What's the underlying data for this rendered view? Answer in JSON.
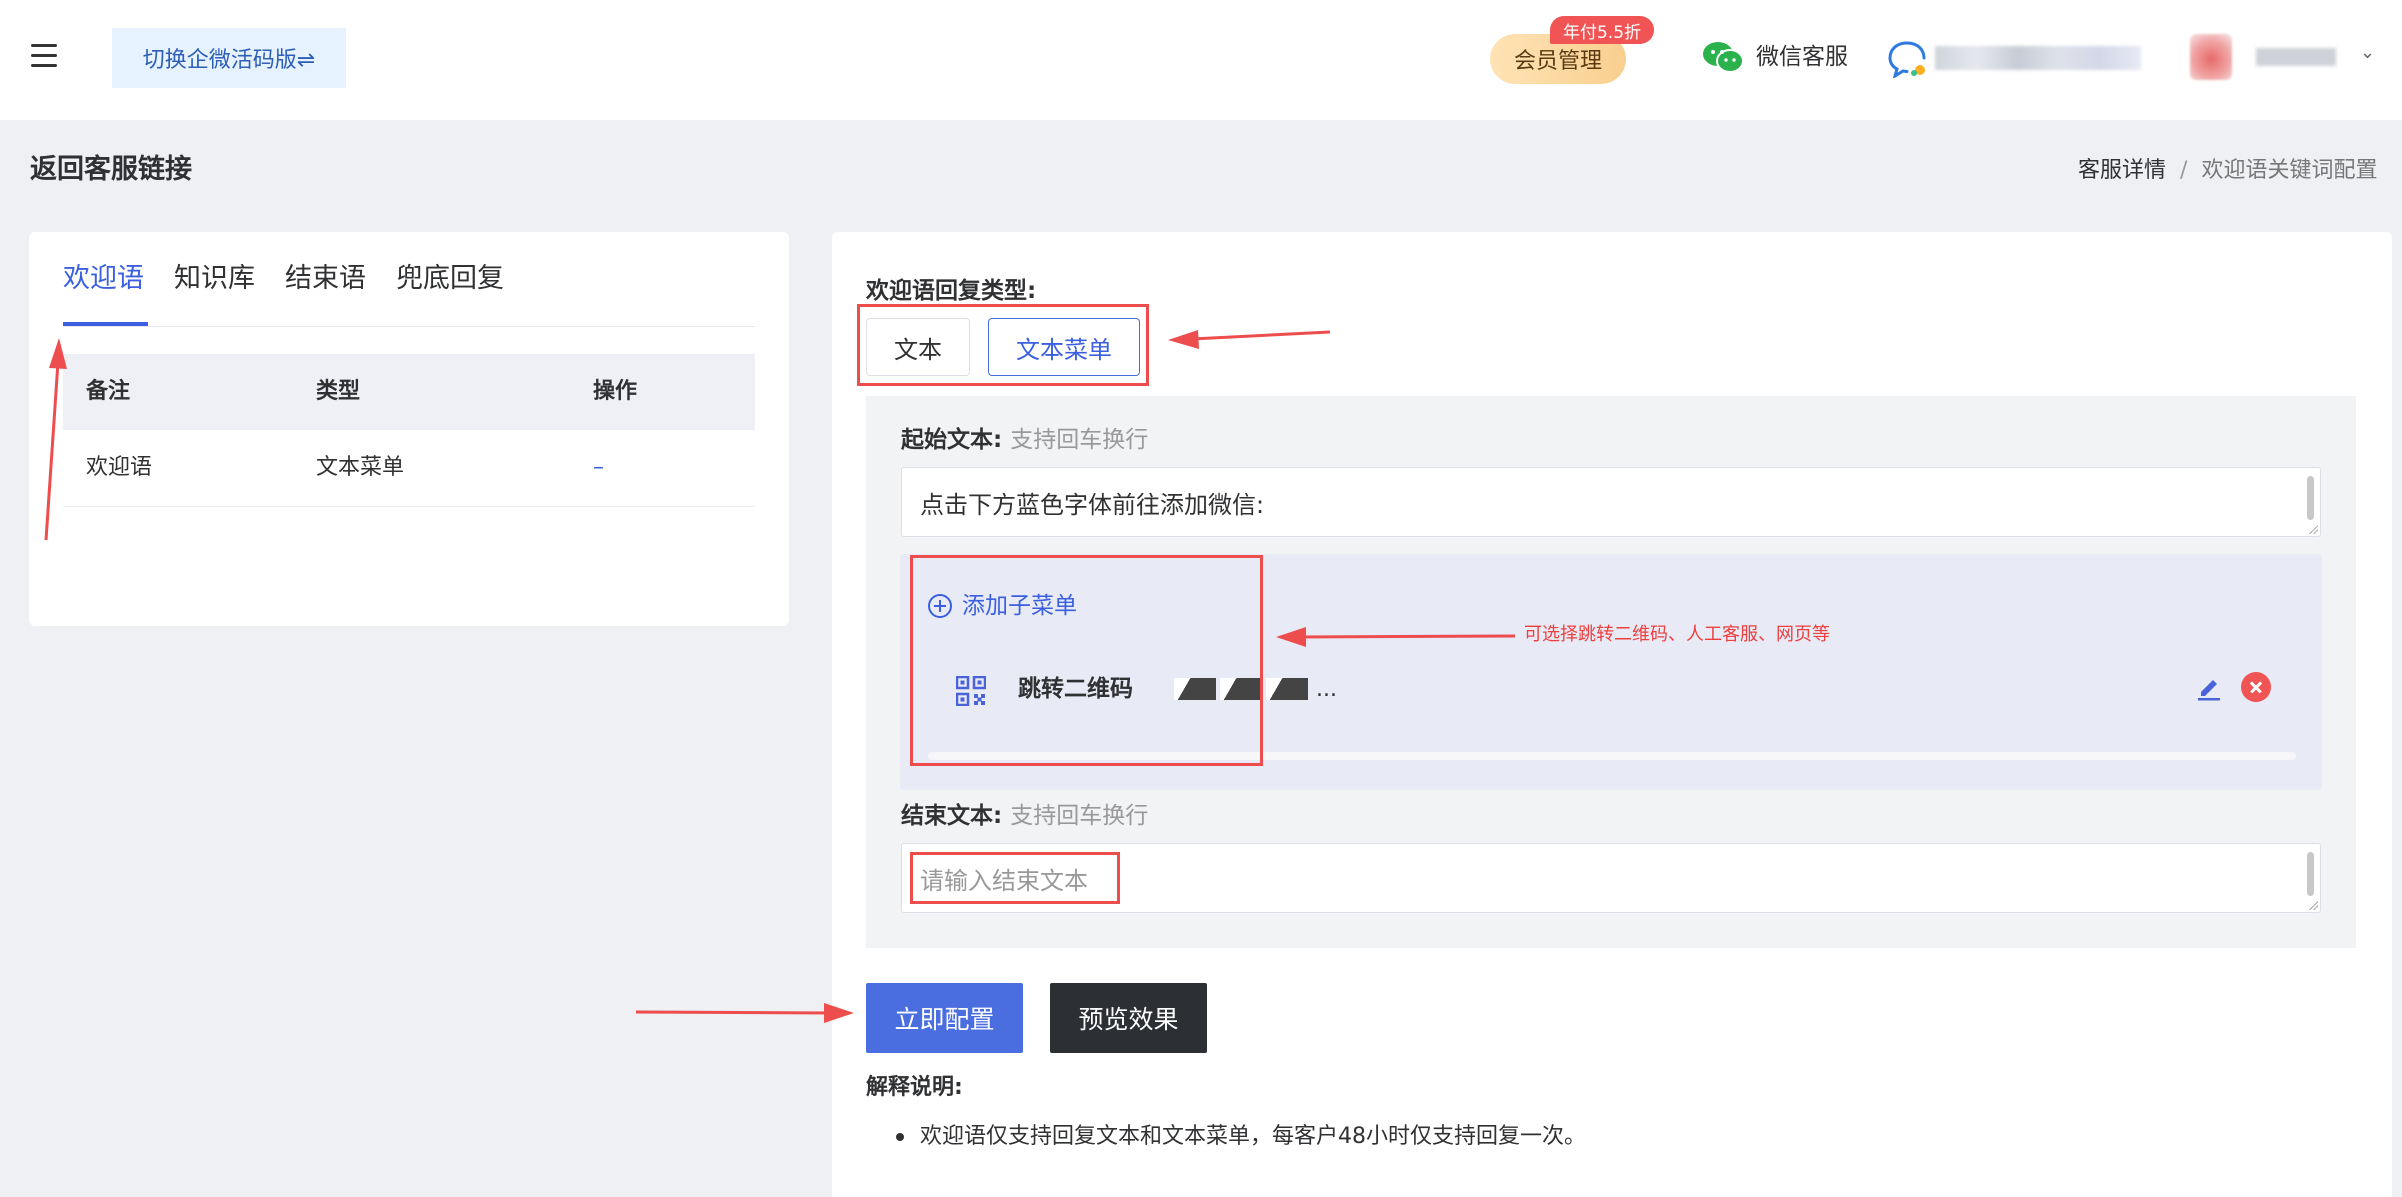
{
  "header": {
    "switch_label": "切换企微活码版⇌",
    "member_label": "会员管理",
    "discount_badge": "年付5.5折",
    "wechat_service_label": "微信客服"
  },
  "page": {
    "back_link": "返回客服链接",
    "breadcrumb": [
      "客服详情",
      "/",
      "欢迎语关键词配置"
    ]
  },
  "left": {
    "tabs": [
      "欢迎语",
      "知识库",
      "结束语",
      "兜底回复"
    ],
    "columns": [
      "备注",
      "类型",
      "操作"
    ],
    "rows": [
      {
        "remark": "欢迎语",
        "type": "文本菜单",
        "action": "–"
      }
    ]
  },
  "right": {
    "reply_type_label": "欢迎语回复类型:",
    "type_options": [
      "文本",
      "文本菜单"
    ],
    "selected_type": "文本菜单",
    "start_label": "起始文本:",
    "start_hint": "支持回车换行",
    "start_value": "点击下方蓝色字体前往添加微信:",
    "add_submenu": "添加子菜单",
    "submenu_item": {
      "label": "跳转二维码",
      "value_suffix": "..."
    },
    "end_label": "结束文本:",
    "end_hint": "支持回车换行",
    "end_placeholder": "请输入结束文本",
    "apply_button": "立即配置",
    "preview_button": "预览效果",
    "notes_title": "解释说明:",
    "notes": [
      "欢迎语仅支持回复文本和文本菜单，每客户48小时仅支持回复一次。"
    ]
  },
  "annotations": {
    "submenu_note": "可选择跳转二维码、人工客服、网页等",
    "color": "#ee4d4d"
  },
  "colors": {
    "accent": "#4a6ee0",
    "dark": "#2c2f33",
    "danger": "#f05454"
  }
}
